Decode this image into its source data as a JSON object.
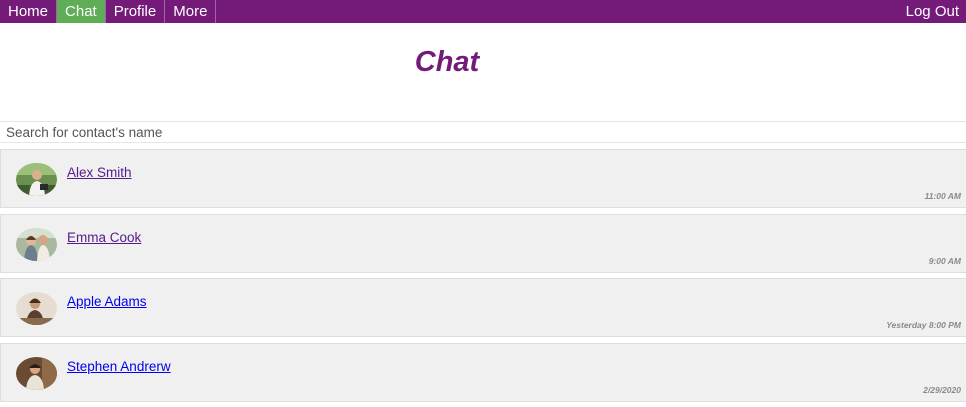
{
  "nav": {
    "home": "Home",
    "chat": "Chat",
    "profile": "Profile",
    "more": "More",
    "logout": "Log Out"
  },
  "page": {
    "title": "Chat"
  },
  "search": {
    "placeholder": "Search for contact's name"
  },
  "contacts": [
    {
      "name": "Alex Smith",
      "time": "11:00 AM"
    },
    {
      "name": "Emma Cook",
      "time": "9:00 AM"
    },
    {
      "name": "Apple Adams",
      "time": "Yesterday 8:00 PM"
    },
    {
      "name": "Stephen Andrerw",
      "time": "2/29/2020"
    }
  ],
  "colors": {
    "nav_bg": "#741b79",
    "nav_active": "#5fad56",
    "title": "#741b79",
    "row_bg": "#f0f0f0",
    "visited_link": "#551a8b",
    "link": "#0000ee",
    "time_text": "#8a8a8a"
  }
}
